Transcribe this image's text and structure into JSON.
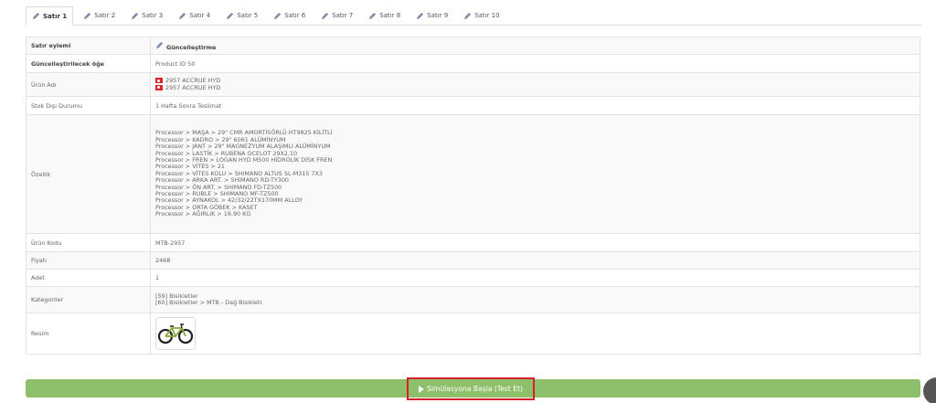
{
  "tabs": [
    {
      "label": "Satır 1",
      "active": true
    },
    {
      "label": "Satır 2"
    },
    {
      "label": "Satır 3"
    },
    {
      "label": "Satır 4"
    },
    {
      "label": "Satır 5"
    },
    {
      "label": "Satır 6"
    },
    {
      "label": "Satır 7"
    },
    {
      "label": "Satır 8"
    },
    {
      "label": "Satır 9"
    },
    {
      "label": "Satır 10"
    }
  ],
  "table": {
    "action_label": "Satır eylemi",
    "action_value": "Güncelleştirme",
    "item_label": "Güncelleştirilecek öğe",
    "item_value": "Product ID 50",
    "name_label": "Ürün Adı",
    "name_values": [
      "2957 ACCRUE HYD",
      "2957 ACCRUE HYD"
    ],
    "stock_label": "Stok Dışı Durumu",
    "stock_value": "1 Hafta Sonra Teslimat",
    "features_label": "Özellik",
    "features": [
      "Processor > MAŞA > 29\" CMR AMORTİSÖRLÜ HT9825 KİLİTLİ",
      "Processor > KADRO > 29\" 6061 ALÜMİNYUM",
      "Processor > JANT > 29\" MAGNEZYUM ALAŞIMLI ALÜMİNYUM",
      "Processor > LASTİK > RUBENA OCELOT 29X2,10",
      "Processor > FREN > LOGAN HYD M500 HİDROLİK DİSK FREN",
      "Processor > VİTES > 21",
      "Processor > VİTES KOLU > SHIMANO ALTUS SL-M315 7X3",
      "Processor > ARKA ART. > SHIMANO RD-TY300",
      "Processor > ÖN ART. > SHIMANO FD-TZ500",
      "Processor > RUBLE > SHIMANO MF-TZ500",
      "Processor > AYNAKOL > 42/32/22TX170MM ALLOY",
      "Processor > ORTA GÖBEK > KASET",
      "Processor > AĞIRLIK > 16.90 KG"
    ],
    "code_label": "Ürün Kodu",
    "code_value": "MTB-2957",
    "price_label": "Fiyatı",
    "price_value": "2468",
    "qty_label": "Adet",
    "qty_value": "1",
    "categories_label": "Kategoriler",
    "categories": [
      "[59] Bisikletler",
      "[60] Bisikletler > MTB - Dağ Bisikleti"
    ],
    "image_label": "Resim"
  },
  "simulate_button": "Simülasyona Başla (Test Et)",
  "colors": {
    "accent_green": "#8ebf6b",
    "highlight_red": "#d4202a",
    "flag_red": "#d8232a"
  }
}
